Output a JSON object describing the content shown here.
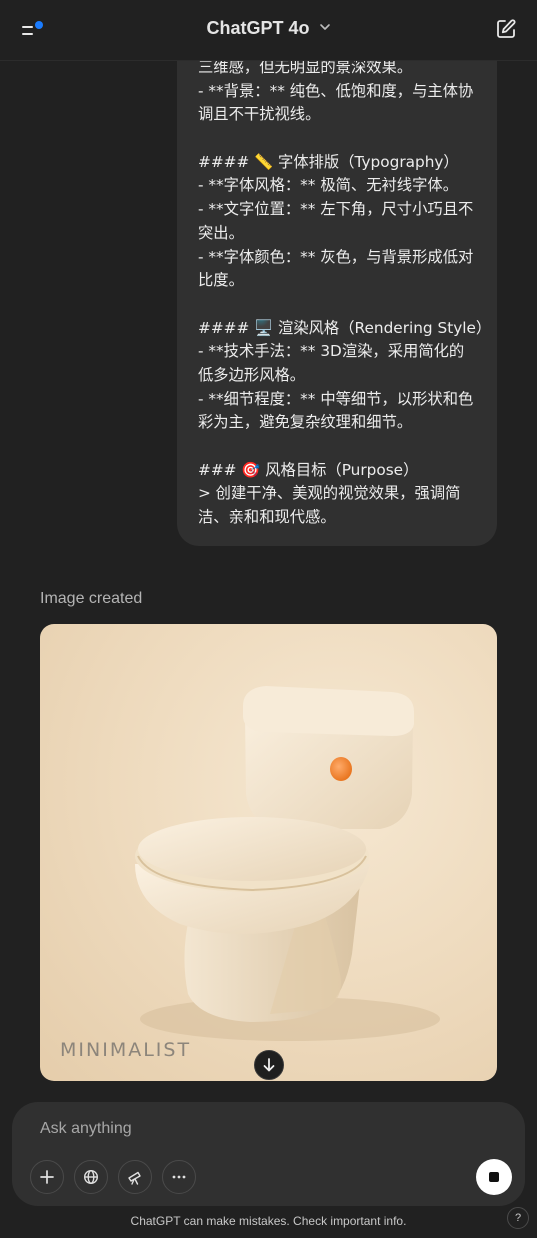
{
  "header": {
    "model_name": "ChatGPT 4o",
    "has_notification": true
  },
  "user_message": {
    "lines": [
      "三维感，但无明显的景深效果。",
      "- **背景：** 纯色、低饱和度，与主体协",
      "调且不干扰视线。",
      "",
      "#### 📏 字体排版（Typography）",
      "- **字体风格：** 极简、无衬线字体。",
      "- **文字位置：** 左下角，尺寸小巧且不",
      "突出。",
      "- **字体颜色：** 灰色，与背景形成低对",
      "比度。",
      "",
      "#### 🖥️ 渲染风格（Rendering Style）",
      "- **技术手法：** 3D渲染，采用简化的",
      "低多边形风格。",
      "- **细节程度：** 中等细节，以形状和色",
      "彩为主，避免复杂纹理和细节。",
      "",
      "### 🎯 风格目标（Purpose）",
      "> 创建干净、美观的视觉效果，强调简",
      "洁、亲和和现代感。"
    ]
  },
  "assistant": {
    "image_label": "Image created",
    "image_subject": "toilet",
    "image_watermark": "MINIMALIST",
    "accent_color": "#f2883a"
  },
  "composer": {
    "placeholder": "Ask anything",
    "tools": [
      "plus-icon",
      "globe-icon",
      "telescope-icon",
      "more-icon"
    ]
  },
  "footer": {
    "disclaimer": "ChatGPT can make mistakes. Check important info.",
    "help_label": "?"
  },
  "colors": {
    "background": "#212121",
    "bubble": "#303030",
    "notification": "#1a7cff"
  }
}
